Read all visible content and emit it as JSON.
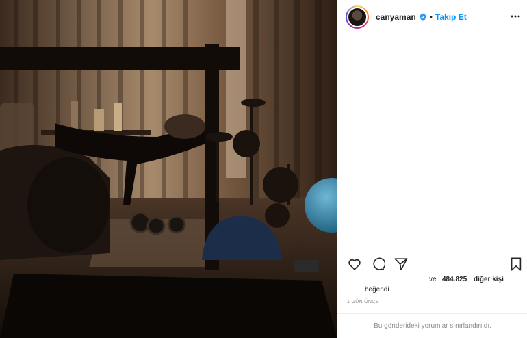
{
  "post": {
    "username": "canyaman",
    "follow_label": "Takip Et",
    "dot": "•",
    "likes_prefix": "ve",
    "likes_count": "484.825",
    "likes_suffix": "diğer kişi",
    "liked_label": "beğendi",
    "time_ago": "1 GÜN ÖNCE",
    "comments_restricted": "Bu gönderideki yorumlar sınırlandırıldı."
  },
  "icons": {
    "verified": "verified-badge-icon",
    "more": "more-options-icon",
    "like": "heart-icon",
    "comment": "comment-icon",
    "share": "share-icon",
    "save": "bookmark-icon"
  },
  "colors": {
    "accent": "#0095f6",
    "text": "#262626",
    "muted": "#8e8e8e",
    "border": "#efefef"
  }
}
